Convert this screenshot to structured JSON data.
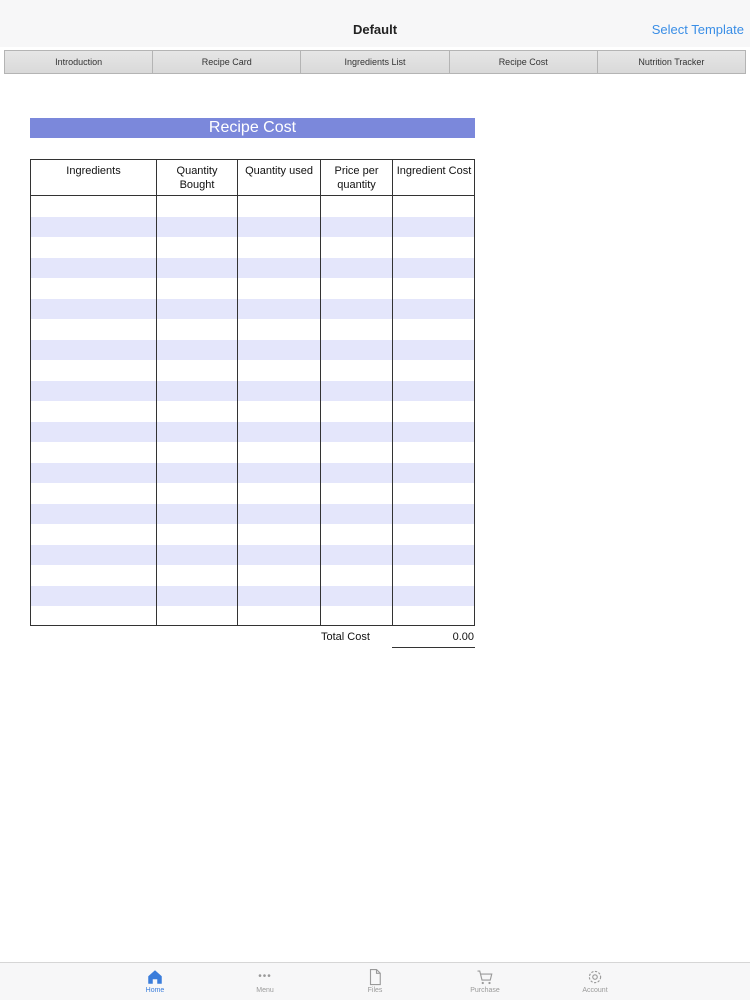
{
  "nav": {
    "title": "Default",
    "select_template": "Select Template"
  },
  "tabs": [
    "Introduction",
    "Recipe Card",
    "Ingredients List",
    "Recipe Cost",
    "Nutrition Tracker"
  ],
  "sheet": {
    "title": "Recipe Cost",
    "headers": {
      "ingredients": "Ingredients",
      "quantity_bought": "Quantity\nBought",
      "quantity_used": "Quantity used",
      "price_per_quantity": "Price per\nquantity",
      "ingredient_cost": "Ingredient Cost"
    },
    "total_label": "Total Cost",
    "total_value": "0.00"
  },
  "tabbar": [
    {
      "label": "Home",
      "icon": "home-icon",
      "active": true
    },
    {
      "label": "Menu",
      "icon": "more-icon",
      "active": false
    },
    {
      "label": "Files",
      "icon": "file-icon",
      "active": false
    },
    {
      "label": "Purchase",
      "icon": "cart-icon",
      "active": false
    },
    {
      "label": "Account",
      "icon": "gear-icon",
      "active": false
    }
  ],
  "colors": {
    "accent": "#3a7ddb",
    "title_band": "#7b88db",
    "row_stripe": "#e4e6fb"
  }
}
